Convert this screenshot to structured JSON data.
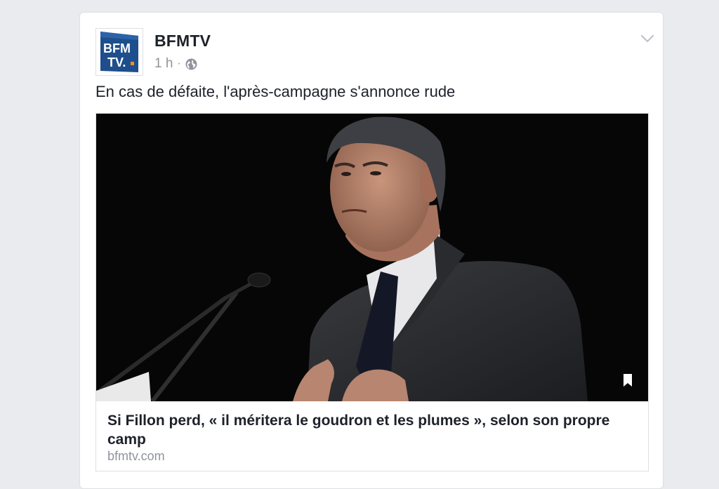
{
  "post": {
    "page_name": "BFMTV",
    "time": "1 h",
    "separator": "·",
    "audience_icon": "globe-icon",
    "menu_icon": "chevron-down-icon",
    "status_text": "En cas de défaite, l'après-campagne s'annonce rude",
    "avatar": {
      "logo_line1": "BFM",
      "logo_line2": "TV.",
      "color_primary": "#1e4e8c",
      "color_accent": "#f28c28"
    }
  },
  "link_preview": {
    "image_description_icon": "photo",
    "save_icon": "bookmark-icon",
    "title": "Si Fillon perd, « il méritera le goudron et les plumes », selon son propre camp",
    "domain": "bfmtv.com"
  },
  "colors": {
    "background": "#e9ebee",
    "card": "#ffffff",
    "text_primary": "#1d2129",
    "text_secondary": "#90949c",
    "border": "#dddfe2"
  }
}
